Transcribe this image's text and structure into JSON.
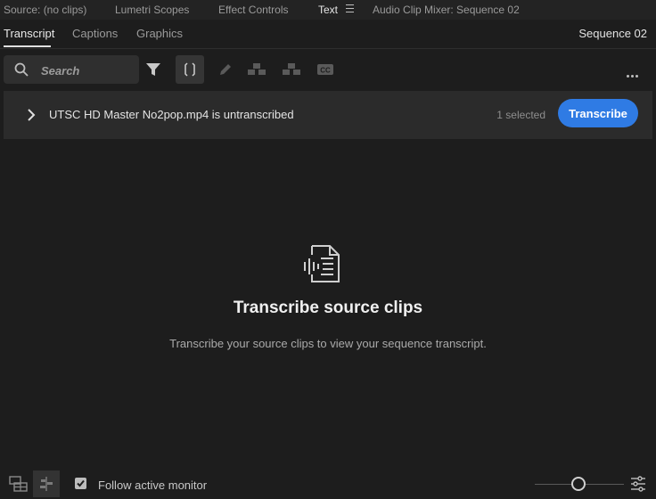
{
  "panel_tabs": [
    {
      "label": "Source: (no clips)"
    },
    {
      "label": "Lumetri Scopes"
    },
    {
      "label": "Effect Controls"
    },
    {
      "label": "Text"
    },
    {
      "label": "Audio Clip Mixer: Sequence 02"
    }
  ],
  "active_panel_tab": "Text",
  "sub_tabs": [
    {
      "label": "Transcript"
    },
    {
      "label": "Captions"
    },
    {
      "label": "Graphics"
    }
  ],
  "active_sub_tab": "Transcript",
  "sequence_name": "Sequence 02",
  "search": {
    "placeholder": "Search",
    "value": ""
  },
  "toolbar_icons": [
    "search-icon",
    "filter-icon",
    "split-icon",
    "pencil-icon",
    "merge-icon",
    "speaker-icon",
    "cc-icon",
    "more-icon"
  ],
  "clip": {
    "name": "UTSC HD Master No2pop.mp4 is untranscribed",
    "selected_count": "1 selected",
    "transcribe_label": "Transcribe"
  },
  "empty_state": {
    "title": "Transcribe source clips",
    "description": "Transcribe your source clips to view your sequence transcript."
  },
  "footer": {
    "follow_label": "Follow active monitor",
    "follow_checked": true
  },
  "colors": {
    "accent": "#2f7be4",
    "background": "#1d1d1d"
  }
}
